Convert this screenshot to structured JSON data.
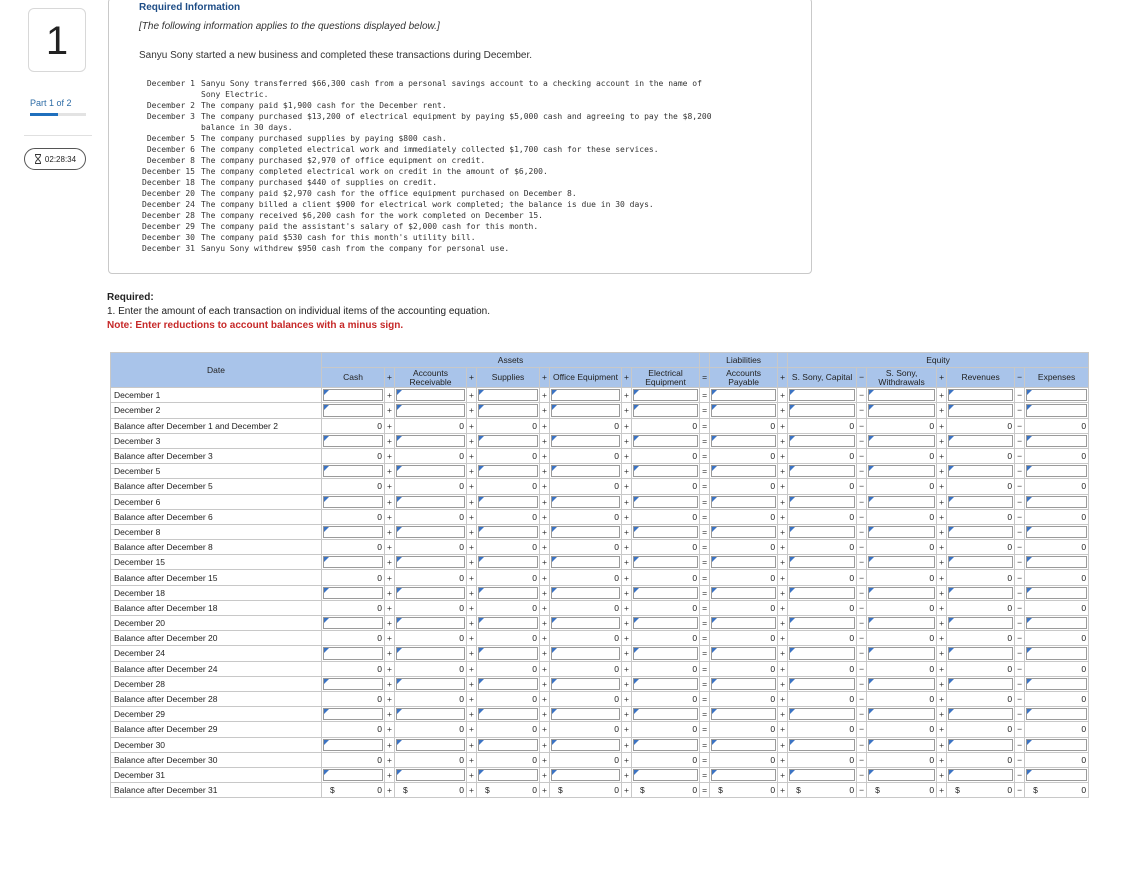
{
  "sidebar": {
    "question_number": "1",
    "part_label": "Part 1 of 2",
    "part_progress": 0.5,
    "timer": "02:28:34"
  },
  "info": {
    "heading": "Required Information",
    "applies": "[The following information applies to the questions displayed below.]",
    "intro": "Sanyu Sony started a new business and completed these transactions during December.",
    "transactions": [
      {
        "date": "December 1",
        "text": "Sanyu Sony transferred $66,300 cash from a personal savings account to a checking account in the name of\nSony Electric."
      },
      {
        "date": "December 2",
        "text": "The company paid $1,900 cash for the December rent."
      },
      {
        "date": "December 3",
        "text": "The company purchased $13,200 of electrical equipment by paying $5,000 cash and agreeing to pay the $8,200\nbalance in 30 days."
      },
      {
        "date": "December 5",
        "text": "The company purchased supplies by paying $800 cash."
      },
      {
        "date": "December 6",
        "text": "The company completed electrical work and immediately collected $1,700 cash for these services."
      },
      {
        "date": "December 8",
        "text": "The company purchased $2,970 of office equipment on credit."
      },
      {
        "date": "December 15",
        "text": "The company completed electrical work on credit in the amount of $6,200."
      },
      {
        "date": "December 18",
        "text": "The company purchased $440 of supplies on credit."
      },
      {
        "date": "December 20",
        "text": "The company paid $2,970 cash for the office equipment purchased on December 8."
      },
      {
        "date": "December 24",
        "text": "The company billed a client $900 for electrical work completed; the balance is due in 30 days."
      },
      {
        "date": "December 28",
        "text": "The company received $6,200 cash for the work completed on December 15."
      },
      {
        "date": "December 29",
        "text": "The company paid the assistant's salary of $2,000 cash for this month."
      },
      {
        "date": "December 30",
        "text": "The company paid $530 cash for this month's utility bill."
      },
      {
        "date": "December 31",
        "text": "Sanyu Sony withdrew $950 cash from the company for personal use."
      }
    ]
  },
  "required": {
    "label": "Required:",
    "instruction": "1. Enter the amount of each transaction on individual items of the accounting equation.",
    "note": "Note: Enter reductions to account balances with a minus sign."
  },
  "table": {
    "group_assets": "Assets",
    "group_liabilities": "Liabilities",
    "group_equity": "Equity",
    "date_header": "Date",
    "columns": [
      "Cash",
      "Accounts Receivable",
      "Supplies",
      "Office Equipment",
      "Electrical Equipment",
      "Accounts Payable",
      "S. Sony, Capital",
      "S. Sony, Withdrawals",
      "Revenues",
      "Expenses"
    ],
    "operators": [
      "+",
      "+",
      "+",
      "+",
      "=",
      "+",
      "−",
      "+",
      "−"
    ],
    "rows": [
      {
        "label": "December 1",
        "type": "input"
      },
      {
        "label": "December 2",
        "type": "input"
      },
      {
        "label": "Balance after December 1 and December 2",
        "type": "balance"
      },
      {
        "label": "December 3",
        "type": "input"
      },
      {
        "label": "Balance after December 3",
        "type": "balance"
      },
      {
        "label": "December 5",
        "type": "input"
      },
      {
        "label": "Balance after December 5",
        "type": "balance"
      },
      {
        "label": "December 6",
        "type": "input"
      },
      {
        "label": "Balance after December 6",
        "type": "balance"
      },
      {
        "label": "December 8",
        "type": "input"
      },
      {
        "label": "Balance after December 8",
        "type": "balance"
      },
      {
        "label": "December 15",
        "type": "input"
      },
      {
        "label": "Balance after December 15",
        "type": "balance"
      },
      {
        "label": "December 18",
        "type": "input"
      },
      {
        "label": "Balance after December 18",
        "type": "balance"
      },
      {
        "label": "December 20",
        "type": "input"
      },
      {
        "label": "Balance after December 20",
        "type": "balance"
      },
      {
        "label": "December 24",
        "type": "input"
      },
      {
        "label": "Balance after December 24",
        "type": "balance"
      },
      {
        "label": "December 28",
        "type": "input"
      },
      {
        "label": "Balance after December 28",
        "type": "balance"
      },
      {
        "label": "December 29",
        "type": "input"
      },
      {
        "label": "Balance after December 29",
        "type": "balance"
      },
      {
        "label": "December 30",
        "type": "input"
      },
      {
        "label": "Balance after December 30",
        "type": "balance"
      },
      {
        "label": "December 31",
        "type": "input"
      },
      {
        "label": "Balance after December 31",
        "type": "final"
      }
    ],
    "balance_value": "0",
    "currency_symbol": "$"
  },
  "colors": {
    "header_bg": "#a9c4ea",
    "heading": "#1e4d86",
    "note": "#c62828",
    "input_flag": "#3b73c3"
  }
}
